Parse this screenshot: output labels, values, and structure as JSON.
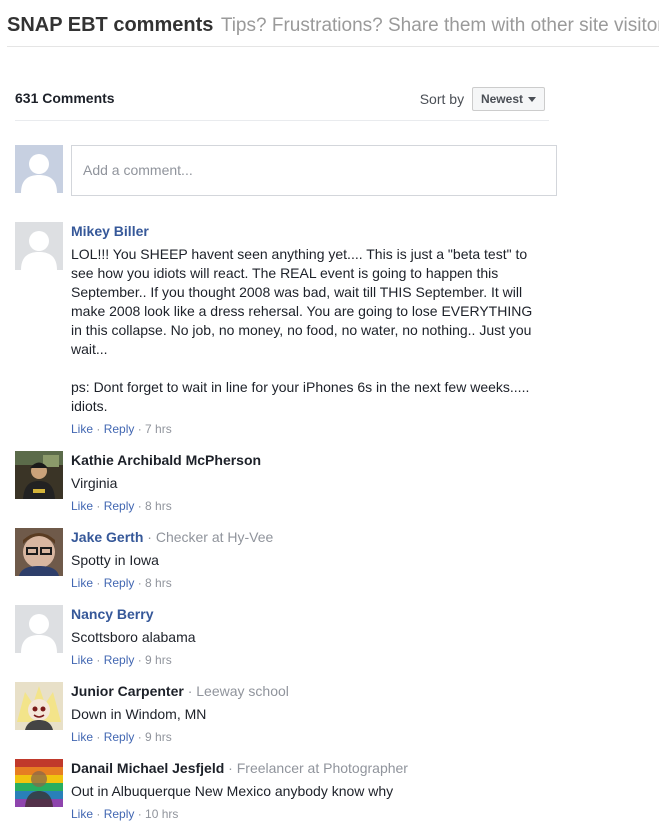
{
  "header": {
    "title": "SNAP EBT comments",
    "subtitle": "Tips? Frustrations? Share them with other site visitors:"
  },
  "plugin": {
    "count_label": "631 Comments",
    "sort_label": "Sort by",
    "sort_value": "Newest",
    "input_placeholder": "Add a comment..."
  },
  "comments": [
    {
      "author": "Mikey Biller",
      "org": "",
      "avatar": "default-silhouette",
      "text_1": "LOL!!! You SHEEP havent seen anything yet.... This is just a \"beta test\" to see how you idiots will react. The REAL event is going to happen this September.. If you thought 2008 was bad, wait till THIS September. It will make 2008 look like a dress rehersal. You are going to lose EVERYTHING in this collapse. No job, no money, no food, no water, no nothing.. Just you wait...",
      "text_2": "ps: Dont forget to wait in line for your iPhones 6s in the next few weeks..... idiots.",
      "like": "Like",
      "reply": "Reply",
      "time": "7 hrs"
    },
    {
      "author": "Kathie Archibald McPherson",
      "org": "",
      "avatar": "photo",
      "text_1": "Virginia",
      "like": "Like",
      "reply": "Reply",
      "time": "8 hrs"
    },
    {
      "author": "Jake Gerth",
      "org": "Checker at Hy-Vee",
      "avatar": "photo",
      "text_1": "Spotty in Iowa",
      "like": "Like",
      "reply": "Reply",
      "time": "8 hrs"
    },
    {
      "author": "Nancy Berry",
      "org": "",
      "avatar": "default-silhouette",
      "text_1": "Scottsboro alabama",
      "like": "Like",
      "reply": "Reply",
      "time": "9 hrs"
    },
    {
      "author": "Junior Carpenter",
      "org": "Leeway school",
      "avatar": "photo",
      "text_1": "Down in Windom, MN",
      "like": "Like",
      "reply": "Reply",
      "time": "9 hrs"
    },
    {
      "author": "Danail Michael Jesfjeld",
      "org": "Freelancer at Photographer",
      "avatar": "photo",
      "text_1": "Out in Albuquerque New Mexico anybody know why",
      "like": "Like",
      "reply": "Reply",
      "time": "10 hrs"
    }
  ],
  "colors": {
    "link": "#365899",
    "action": "#4267b2",
    "muted": "#90949c",
    "text": "#1d2129"
  }
}
